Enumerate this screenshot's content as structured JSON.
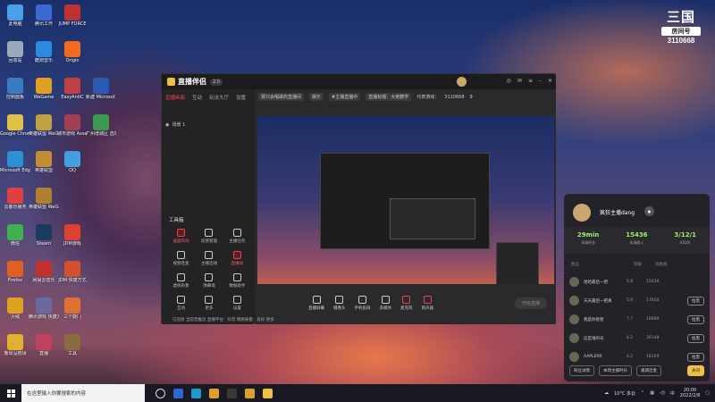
{
  "desktop_icons": [
    {
      "label": "此电脑",
      "col": 0,
      "row": 0,
      "color": "#4aa0e8"
    },
    {
      "label": "腾讯工作",
      "col": 1,
      "row": 0,
      "color": "#3a6ad0"
    },
    {
      "label": "JUMP FORCE",
      "col": 2,
      "row": 0,
      "color": "#c03030"
    },
    {
      "label": "回收站",
      "col": 0,
      "row": 1,
      "color": "#9ab"
    },
    {
      "label": "酷狗音乐",
      "col": 1,
      "row": 1,
      "color": "#2a8ae0"
    },
    {
      "label": "Origin",
      "col": 2,
      "row": 1,
      "color": "#f06a20"
    },
    {
      "label": "控制面板",
      "col": 0,
      "row": 2,
      "color": "#3a7ac0"
    },
    {
      "label": "WeGame",
      "col": 1,
      "row": 2,
      "color": "#e0a020"
    },
    {
      "label": "EasyAntiC",
      "col": 2,
      "row": 2,
      "color": "#c04040"
    },
    {
      "label": "新建 Microsof...",
      "col": 3,
      "row": 2,
      "color": "#2a5ab0"
    },
    {
      "label": "Google Chrome",
      "col": 0,
      "row": 3,
      "color": "#e0c040"
    },
    {
      "label": "英雄联盟 WeGame版",
      "col": 1,
      "row": 3,
      "color": "#c0a040"
    },
    {
      "label": "城市游戏 Assetc...",
      "col": 2,
      "row": 3,
      "color": "#a04050"
    },
    {
      "label": "广州增城区 选举制度",
      "col": 3,
      "row": 3,
      "color": "#3a9a50"
    },
    {
      "label": "Microsoft Edge",
      "col": 0,
      "row": 4,
      "color": "#2a90d0"
    },
    {
      "label": "英雄联盟",
      "col": 1,
      "row": 4,
      "color": "#c09030"
    },
    {
      "label": "QQ",
      "col": 2,
      "row": 4,
      "color": "#40a0e0"
    },
    {
      "label": "云备份服务",
      "col": 0,
      "row": 5,
      "color": "#e04040"
    },
    {
      "label": "英雄联盟 WeGame版",
      "col": 1,
      "row": 5,
      "color": "#b08030"
    },
    {
      "label": "微信",
      "col": 0,
      "row": 6,
      "color": "#40b050"
    },
    {
      "label": "Steam",
      "col": 1,
      "row": 6,
      "color": "#1a3a60"
    },
    {
      "label": "JDM游戏",
      "col": 2,
      "row": 6,
      "color": "#e04030"
    },
    {
      "label": "Firefox",
      "col": 0,
      "row": 7,
      "color": "#e06020"
    },
    {
      "label": "网易云音乐",
      "col": 1,
      "row": 7,
      "color": "#c03030"
    },
    {
      "label": "JDM 快捷方式",
      "col": 2,
      "row": 7,
      "color": "#d05030"
    },
    {
      "label": "火绒",
      "col": 0,
      "row": 8,
      "color": "#e0a020"
    },
    {
      "label": "腾讯游戏 快捷方式",
      "col": 1,
      "row": 8,
      "color": "#6a6aa0"
    },
    {
      "label": "三个敲门",
      "col": 2,
      "row": 8,
      "color": "#e07030"
    },
    {
      "label": "熊出没剧场",
      "col": 0,
      "row": 9,
      "color": "#e0b030"
    },
    {
      "label": "直播",
      "col": 1,
      "row": 9,
      "color": "#c04060"
    },
    {
      "label": "工具",
      "col": 2,
      "row": 9,
      "color": "#8a6a40"
    }
  ],
  "brand": {
    "name": "三国",
    "tag": "房间号",
    "room": "3110668"
  },
  "app": {
    "title": "直播伴侣",
    "version": "2.0",
    "left_tabs": [
      "直播画面",
      "互动",
      "玩法大厅",
      "设置"
    ],
    "scene": "场景 1",
    "tools_title": "工具箱",
    "tools": [
      {
        "label": "画面布局",
        "red": true
      },
      {
        "label": "房管管理",
        "red": false
      },
      {
        "label": "主播任务",
        "red": false
      },
      {
        "label": "视频连麦",
        "red": false
      },
      {
        "label": "主播连线",
        "red": false
      },
      {
        "label": "直播间",
        "red": true
      },
      {
        "label": "虚拟形象",
        "red": false
      },
      {
        "label": "弹幕墙",
        "red": false
      },
      {
        "label": "数据助手",
        "red": false
      },
      {
        "label": "互动",
        "red": false
      },
      {
        "label": "更多",
        "red": false
      },
      {
        "label": "设置",
        "red": false
      }
    ],
    "top_chips": [
      "那只会唱歌的直播间",
      "娱乐",
      "#主播直播中",
      "直播标题：大佬教学",
      "代表游戏：",
      "3110668",
      "9"
    ],
    "bottom_buttons": [
      "直播屏幕",
      "摄像头",
      "手机投屏",
      "多媒体",
      "麦克风",
      "扬声器"
    ],
    "go_live": "开始直播",
    "status": "已连接  当前无推流  直播平台：抖音  网络质量：良好  更多"
  },
  "popup": {
    "name": "疯狂主播dang",
    "stats": [
      {
        "value": "29min",
        "label": "本场时长"
      },
      {
        "value": "15436",
        "label": "本场收入"
      },
      {
        "value": "3/12/1",
        "label": "K/D/A"
      }
    ],
    "columns": [
      "粉丝",
      "等级",
      "贡献值"
    ],
    "rows": [
      {
        "name": "哈哈最后一把",
        "level": "5.8",
        "value": "15436",
        "btn": ""
      },
      {
        "name": "天天最后一把真",
        "level": "5.9",
        "value": "17818",
        "btn": "拉黑"
      },
      {
        "name": "我是你爸爸",
        "level": "7.7",
        "value": "19889",
        "btn": "拉黑"
      },
      {
        "name": "这是谁的号",
        "level": "4.2",
        "value": "26148",
        "btn": "拉黑"
      },
      {
        "name": "AAPLERR",
        "level": "4.2",
        "value": "18169",
        "btn": "拉黑"
      }
    ],
    "footer": [
      "粉丝详情",
      "本场主播时长",
      "邀请连麦",
      "关闭"
    ]
  },
  "taskbar": {
    "search_placeholder": "在这里输入你要搜索的内容",
    "weather": "10°C 多云",
    "time": "20:00",
    "date": "2022/2/8"
  }
}
